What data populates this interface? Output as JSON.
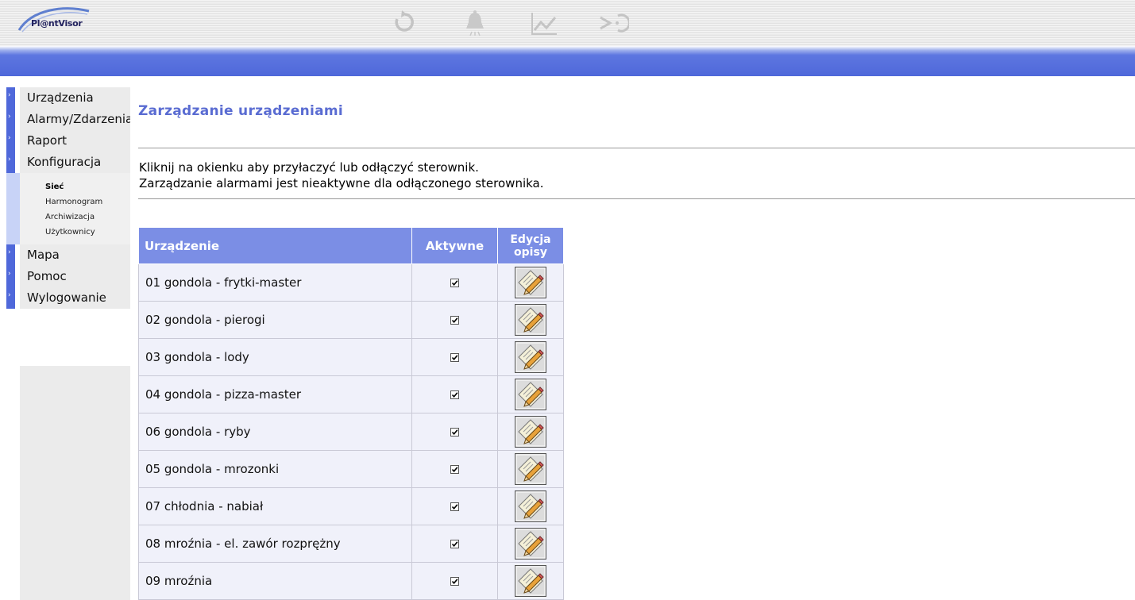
{
  "header": {
    "logo_text": "Pl@ntVisor",
    "icons": [
      "refresh-icon",
      "alarm-bell-icon",
      "chart-trend-icon",
      "exit-icon"
    ]
  },
  "colors": {
    "accent": "#4f68da",
    "table_header": "#7b8ee5",
    "title": "#5a6cd2"
  },
  "sidebar": {
    "items": [
      {
        "label": "Urządzenia"
      },
      {
        "label": "Alarmy/Zdarzenia"
      },
      {
        "label": "Raport"
      },
      {
        "label": "Konfiguracja"
      },
      {
        "label": "Mapa"
      },
      {
        "label": "Pomoc"
      },
      {
        "label": "Wylogowanie"
      }
    ],
    "submenu": [
      {
        "label": "Sieć",
        "active": true
      },
      {
        "label": "Harmonogram",
        "active": false
      },
      {
        "label": "Archiwizacja",
        "active": false
      },
      {
        "label": "Użytkownicy",
        "active": false
      }
    ]
  },
  "main": {
    "title": "Zarządzanie urządzeniami",
    "info_line1": "Kliknij na okienku aby przyłaczyć lub odłączyć sterownik.",
    "info_line2": "Zarządzanie alarmami jest nieaktywne dla odłączonego sterownika."
  },
  "table": {
    "headers": {
      "device": "Urządzenie",
      "active": "Aktywne",
      "edit_line1": "Edycja",
      "edit_line2": "opisy"
    },
    "rows": [
      {
        "name": "01 gondola - frytki-master",
        "active": true
      },
      {
        "name": "02 gondola - pierogi",
        "active": true
      },
      {
        "name": "03 gondola - lody",
        "active": true
      },
      {
        "name": "04 gondola - pizza-master",
        "active": true
      },
      {
        "name": "06 gondola - ryby",
        "active": true
      },
      {
        "name": "05 gondola - mrozonki",
        "active": true
      },
      {
        "name": "07 chłodnia - nabiał",
        "active": true
      },
      {
        "name": "08 mroźnia - el. zawór rozprężny",
        "active": true
      },
      {
        "name": "09 mroźnia",
        "active": true
      }
    ]
  }
}
